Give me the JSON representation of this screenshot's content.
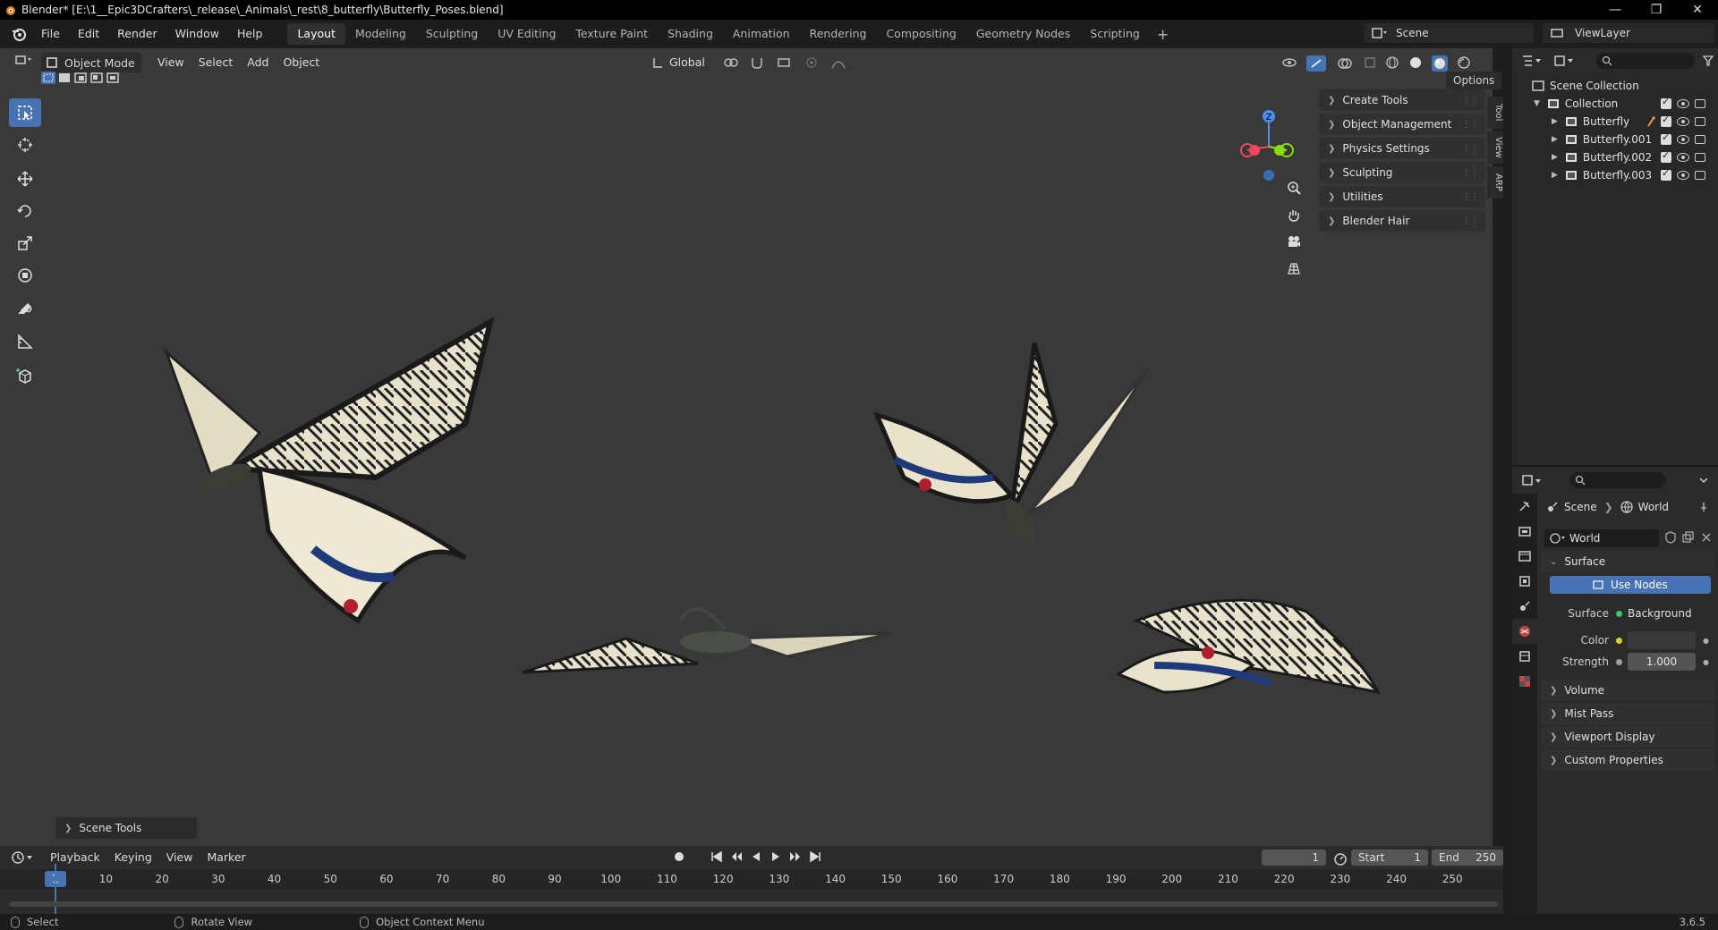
{
  "window": {
    "title": "Blender* [E:\\1__Epic3DCrafters\\_release\\_Animals\\_rest\\8_butterfly\\Butterfly_Poses.blend]",
    "controls": [
      "—",
      "❐",
      "✕"
    ]
  },
  "menubar": {
    "items": [
      "File",
      "Edit",
      "Render",
      "Window",
      "Help"
    ],
    "workspaces": [
      "Layout",
      "Modeling",
      "Sculpting",
      "UV Editing",
      "Texture Paint",
      "Shading",
      "Animation",
      "Rendering",
      "Compositing",
      "Geometry Nodes",
      "Scripting"
    ],
    "active_workspace": "Layout",
    "scene": "Scene",
    "view_layer": "ViewLayer"
  },
  "viewport": {
    "mode": "Object Mode",
    "menus": [
      "View",
      "Select",
      "Add",
      "Object"
    ],
    "orientation": "Global",
    "options_label": "Options",
    "tools": [
      "select-box-icon",
      "cursor-icon",
      "move-icon",
      "rotate-icon",
      "scale-icon",
      "transform-icon",
      "annotate-icon",
      "measure-icon",
      "add-cube-icon"
    ],
    "npanel_items": [
      "Create Tools",
      "Object Management",
      "Physics Settings",
      "Sculpting",
      "Utilities",
      "Blender Hair"
    ],
    "npanel_tabs": [
      "Tool",
      "View",
      "ARP"
    ],
    "gizmo_axis_label": "Z",
    "scene_tools_label": "Scene Tools"
  },
  "timeline": {
    "menus": [
      "Playback",
      "Keying",
      "View",
      "Marker"
    ],
    "current_frame": "1",
    "start_label": "Start",
    "start_value": "1",
    "end_label": "End",
    "end_value": "250",
    "ticks": [
      "1",
      "10",
      "20",
      "30",
      "40",
      "50",
      "60",
      "70",
      "80",
      "90",
      "100",
      "110",
      "120",
      "130",
      "140",
      "150",
      "160",
      "170",
      "180",
      "190",
      "200",
      "210",
      "220",
      "230",
      "240",
      "250"
    ]
  },
  "statusbar": {
    "items": [
      "Select",
      "Rotate View",
      "Object Context Menu"
    ],
    "version": "3.6.5"
  },
  "outliner": {
    "root": "Scene Collection",
    "collection": "Collection",
    "objects": [
      "Butterfly",
      "Butterfly.001",
      "Butterfly.002",
      "Butterfly.003"
    ]
  },
  "properties": {
    "breadcrumb": [
      "Scene",
      "World"
    ],
    "world_name": "World",
    "panels": {
      "surface": "Surface",
      "use_nodes": "Use Nodes",
      "surface_label": "Surface",
      "surface_value": "Background",
      "color_label": "Color",
      "strength_label": "Strength",
      "strength_value": "1.000",
      "collapsed": [
        "Volume",
        "Mist Pass",
        "Viewport Display",
        "Custom Properties"
      ]
    }
  },
  "colors": {
    "accent": "#4772b3",
    "viewport_bg": "#393939",
    "header_bg": "#1d1d1d"
  }
}
